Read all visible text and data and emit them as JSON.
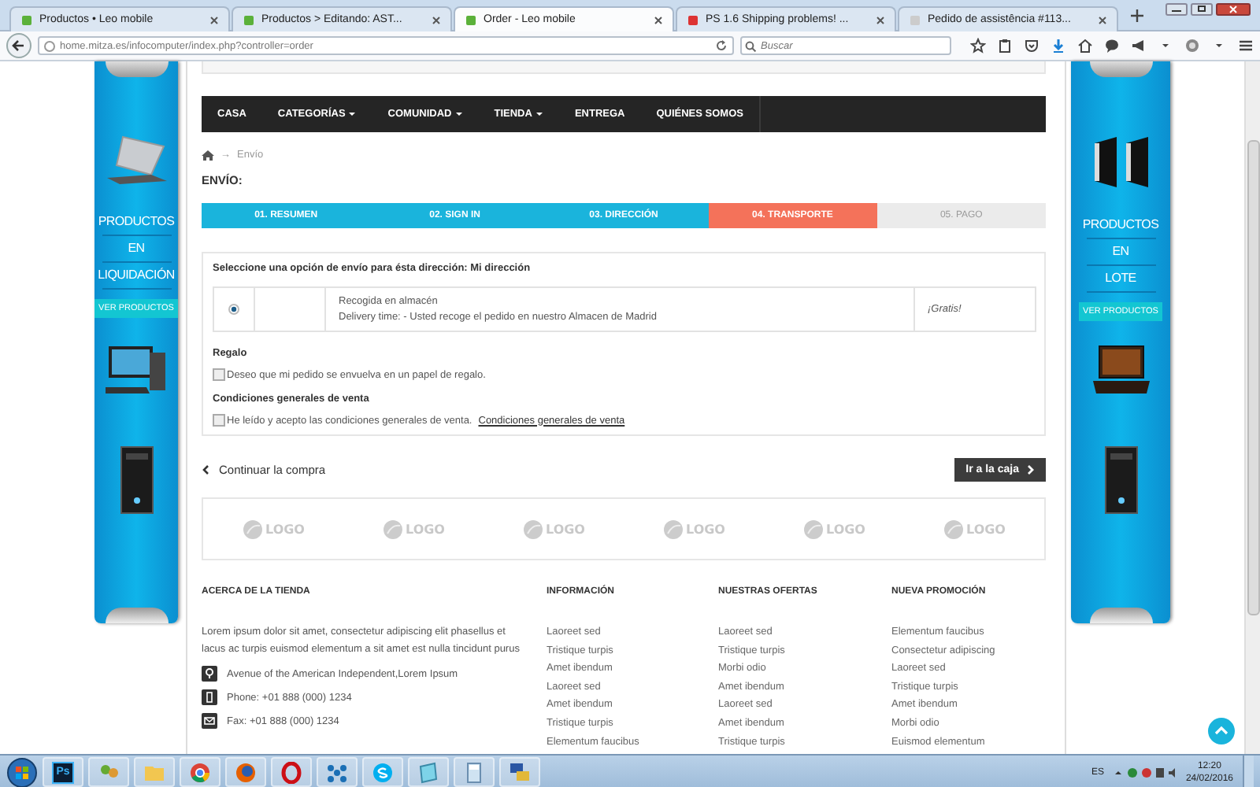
{
  "browser_tabs": [
    {
      "title": "Productos • Leo mobile",
      "selected": false
    },
    {
      "title": "Productos > Editando: AST...",
      "selected": false
    },
    {
      "title": "Order - Leo mobile",
      "selected": true
    },
    {
      "title": "PS 1.6 Shipping problems! ...",
      "selected": false
    },
    {
      "title": "Pedido de assistência #113...",
      "selected": false
    }
  ],
  "address_bar": {
    "url": "home.mitza.es/infocomputer/index.php?controller=order"
  },
  "search": {
    "placeholder": "Buscar"
  },
  "left_banner": {
    "lines": [
      "PRODUCTOS",
      "EN",
      "LIQUIDACIÓN"
    ],
    "button": "VER PRODUCTOS"
  },
  "right_banner": {
    "lines": [
      "PRODUCTOS",
      "EN",
      "LOTE"
    ],
    "button": "VER PRODUCTOS"
  },
  "menu": [
    {
      "label": "CASA",
      "dropdown": false
    },
    {
      "label": "CATEGORÍAS",
      "dropdown": true
    },
    {
      "label": "COMUNIDAD",
      "dropdown": true
    },
    {
      "label": "TIENDA",
      "dropdown": true
    },
    {
      "label": "ENTREGA",
      "dropdown": false
    },
    {
      "label": "QUIÉNES SOMOS",
      "dropdown": false
    }
  ],
  "breadcrumb": {
    "separator": "→",
    "current": "Envío"
  },
  "page_title": "ENVÍO:",
  "steps": [
    {
      "label": "01. RESUMEN",
      "selected": false
    },
    {
      "label": "02. SIGN IN",
      "selected": false
    },
    {
      "label": "03. DIRECCIÓN",
      "selected": false
    },
    {
      "label": "04. TRANSPORTE",
      "selected": true
    },
    {
      "label": "05. PAGO",
      "selected": false
    }
  ],
  "shipping": {
    "heading": "Seleccione una opción de envío para ésta dirección: Mi dirección",
    "options": [
      {
        "selected": true,
        "name": "Recogida en almacén",
        "delivery": "Delivery time: - Usted recoge el pedido en nuestro Almacen de Madrid",
        "price": "¡Gratis!"
      }
    ]
  },
  "gift": {
    "title": "Regalo",
    "label": "Deseo que mi pedido se envuelva en un papel de regalo.",
    "checked": false
  },
  "terms": {
    "title": "Condiciones generales de venta",
    "label": "He leído y acepto las condiciones generales de venta.",
    "link": "Condiciones generales de venta",
    "checked": false
  },
  "continue_link": "Continuar la compra",
  "checkout_button": "Ir a la caja",
  "partner_logos": [
    "LOGO",
    "LOGO",
    "LOGO",
    "LOGO",
    "LOGO",
    "LOGO"
  ],
  "footer": {
    "about": {
      "title": "ACERCA DE LA TIENDA",
      "text": "Lorem ipsum dolor sit amet, consectetur adipiscing elit phasellus et lacus ac turpis euismod elementum a sit amet est nulla tincidunt purus",
      "contacts": [
        {
          "kind": "address",
          "text": "Avenue of the American Independent,Lorem Ipsum"
        },
        {
          "kind": "phone",
          "text": "Phone: +01 888 (000) 1234"
        },
        {
          "kind": "fax",
          "text": "Fax: +01 888 (000) 1234"
        }
      ]
    },
    "columns": [
      {
        "title": "INFORMACIÓN",
        "links": [
          "Laoreet sed",
          "Tristique turpis",
          "Amet ibendum",
          "Laoreet sed",
          "Amet ibendum",
          "Tristique turpis",
          "Elementum faucibus"
        ]
      },
      {
        "title": "NUESTRAS OFERTAS",
        "links": [
          "Laoreet sed",
          "Tristique turpis",
          "Morbi odio",
          "Amet ibendum",
          "Laoreet sed",
          "Amet ibendum",
          "Tristique turpis"
        ]
      },
      {
        "title": "NUEVA PROMOCIÓN",
        "links": [
          "Elementum faucibus",
          "Consectetur adipiscing",
          "Laoreet sed",
          "Tristique turpis",
          "Amet ibendum",
          "Morbi odio",
          "Euismod elementum"
        ]
      }
    ]
  },
  "taskbar": {
    "apps": [
      {
        "kind": "photoshop",
        "label": "Ps"
      },
      {
        "kind": "people"
      },
      {
        "kind": "folder"
      },
      {
        "kind": "chrome"
      },
      {
        "kind": "firefox"
      },
      {
        "kind": "opera"
      },
      {
        "kind": "network"
      },
      {
        "kind": "skype"
      },
      {
        "kind": "notes"
      },
      {
        "kind": "calculator"
      },
      {
        "kind": "remote"
      }
    ],
    "language": "ES",
    "time": "12:20",
    "date": "24/02/2016"
  }
}
